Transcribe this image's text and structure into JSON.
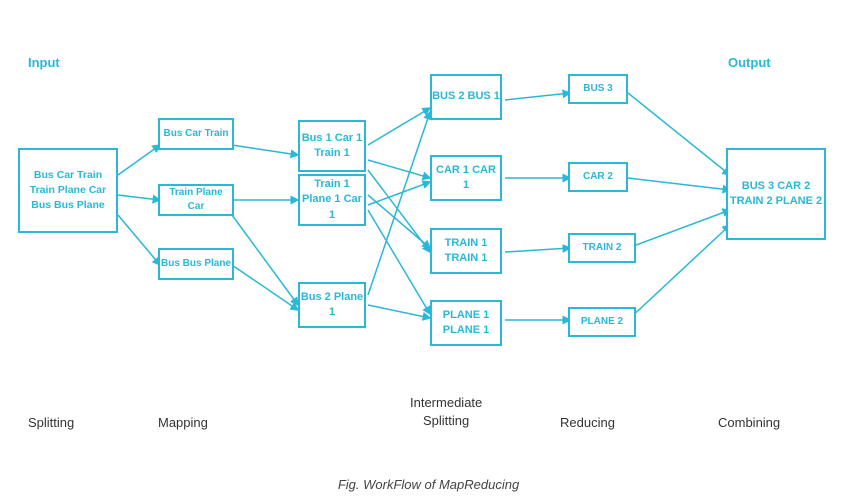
{
  "title": "Fig. WorkFlow of MapReducing",
  "labels": {
    "input": "Input",
    "output": "Output",
    "splitting": "Splitting",
    "mapping": "Mapping",
    "intermediate_splitting": "Intermediate\nSplitting",
    "reducing": "Reducing",
    "combining": "Combining"
  },
  "boxes": {
    "input": "Bus Car Train\nTrain Plane Car\nBus Bus Plane",
    "map1": "Bus Car Train",
    "map2": "Train Plane Car",
    "map3": "Bus Bus Plane",
    "split1": "Bus 1\nCar 1\nTrain 1",
    "split2": "Train 1\nPlane 1\nCar 1",
    "split3": "Bus 2\nPlane 1",
    "inter1": "BUS 2\nBUS 1",
    "inter2": "CAR 1\nCAR 1",
    "inter3": "TRAIN 1\nTRAIN 1",
    "inter4": "PLANE 1\nPLANE 1",
    "red1": "BUS 3",
    "red2": "CAR 2",
    "red3": "TRAIN 2",
    "red4": "PLANE 2",
    "output": "BUS 3\nCAR 2\nTRAIN 2\nPLANE 2"
  }
}
